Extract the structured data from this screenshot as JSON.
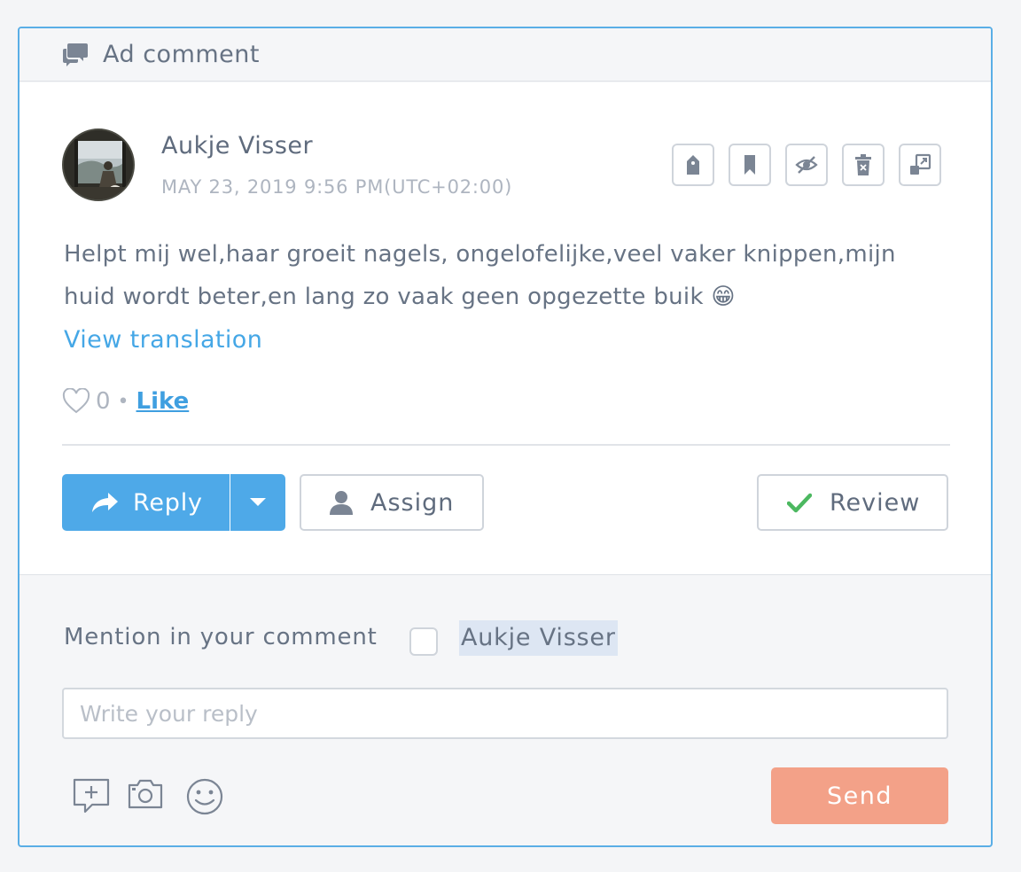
{
  "header": {
    "title": "Ad comment",
    "icon": "comments-icon"
  },
  "comment": {
    "author": "Aukje Visser",
    "date": "MAY 23, 2019 9:56 PM(UTC+02:00)",
    "text": "Helpt mij wel,haar groeit nagels, ongelofelijke,veel vaker knippen,mijn huid wordt beter,en lang zo vaak geen opgezette buik 😁",
    "view_translation": "View translation",
    "like_count": "0",
    "like_separator": "•",
    "like_label": "Like"
  },
  "tools": [
    "tag-icon",
    "bookmark-icon",
    "hide-icon",
    "delete-icon",
    "open-external-icon"
  ],
  "actions": {
    "reply": "Reply",
    "assign": "Assign",
    "review": "Review"
  },
  "mention": {
    "label": "Mention in your comment",
    "name": "Aukje Visser"
  },
  "reply_box": {
    "placeholder": "Write your reply",
    "value": ""
  },
  "send": "Send",
  "colors": {
    "border_accent": "#5aaee6",
    "reply_button": "#4ea9e8",
    "link": "#45a7e6",
    "send_button": "#f3a188",
    "review_check": "#4cb860"
  }
}
